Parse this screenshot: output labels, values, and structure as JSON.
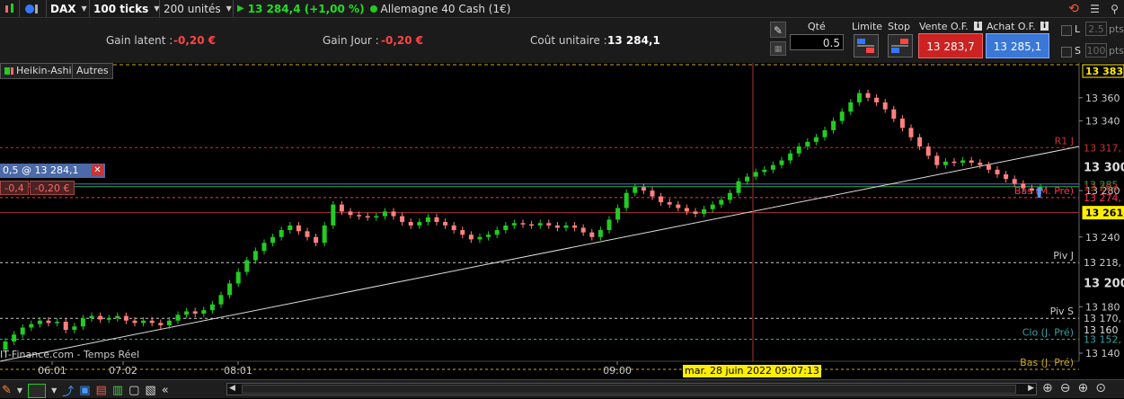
{
  "topbar": {
    "symbol": "DAX",
    "ticks": "100 ticks",
    "units": "200 unités",
    "price_change": "13 284,4 (+1,00 %)",
    "instrument": "Allemagne 40 Cash (1€)"
  },
  "info": {
    "gain_latent_label": "Gain latent :",
    "gain_latent_value": "-0,20 €",
    "gain_jour_label": "Gain Jour :",
    "gain_jour_value": "-0,20 €",
    "cout_label": "Coût unitaire :",
    "cout_value": "13 284,1"
  },
  "order": {
    "qty_label": "Qté",
    "qty_value": "0.5",
    "limite_label": "Limite",
    "stop_label": "Stop",
    "vente_label": "Vente O.F.",
    "achat_label": "Achat O.F.",
    "vente_price": "13 283,7",
    "achat_price": "13 285,1",
    "l_label": "L",
    "l_value": "2.5",
    "s_label": "S",
    "s_value": "100",
    "pts": "pts"
  },
  "chart_tabs": {
    "heikin": "Heikin-Ashi",
    "autres": "Autres"
  },
  "position": {
    "label": "0,5 @ 13 284,1",
    "delta": "-0,4",
    "pnl": "-0,20 €"
  },
  "watermark": "IT-Finance.com - Temps Réel",
  "crosshair_date": "mar. 28 juin 2022 09:07:13",
  "colors": {
    "up": "#22cc22",
    "down": "#ff8080",
    "line_red": "#cc2222",
    "accent_yellow": "#ffee00"
  },
  "chart_data": {
    "type": "candlestick",
    "ylim": [
      13133,
      13390
    ],
    "y_ticks": [
      13140,
      13180,
      13240,
      13280,
      13340,
      13360
    ],
    "x_ticks": [
      "06:01",
      "07:02",
      "08:01",
      "09:00"
    ],
    "levels": [
      {
        "label": "R1 J",
        "value": 13317,
        "axis_label": "13 317,",
        "color": "#cc3333"
      },
      {
        "label": "Bas (M. Pré)",
        "value": 13274,
        "axis_label": "13 274,",
        "color": "#ff3355"
      },
      {
        "label": "Piv J",
        "value": 13218,
        "axis_label": "13 218,",
        "color": "#cccccc"
      },
      {
        "label": "Piv S",
        "value": 13170,
        "axis_label": "13 170,",
        "color": "#cccccc"
      },
      {
        "label": "Clo (J. Pré)",
        "value": 13152,
        "axis_label": "13 152,",
        "color": "#3aa0a0"
      },
      {
        "label": "Bas (J. Pré)",
        "value": 13126,
        "axis_label": "",
        "color": "#ccaa22"
      }
    ],
    "highlight_labels": [
      {
        "value": 13383,
        "text": "13 383,"
      },
      {
        "value": 13261,
        "text": "13 261,"
      }
    ],
    "current_price_labels": [
      {
        "value": 13300,
        "text": "13 300"
      },
      {
        "value": 13285,
        "text": "13 285"
      },
      {
        "value": 13283,
        "text": "13 283,"
      },
      {
        "value": 13200,
        "text": "13 200"
      },
      {
        "value": 13160,
        "text": "13 160"
      }
    ],
    "candles": [
      [
        13143,
        13150
      ],
      [
        13150,
        13156
      ],
      [
        13156,
        13162
      ],
      [
        13162,
        13165
      ],
      [
        13165,
        13168
      ],
      [
        13168,
        13166
      ],
      [
        13166,
        13167
      ],
      [
        13167,
        13160
      ],
      [
        13160,
        13163
      ],
      [
        13163,
        13170
      ],
      [
        13170,
        13172
      ],
      [
        13172,
        13169
      ],
      [
        13169,
        13170
      ],
      [
        13170,
        13172
      ],
      [
        13172,
        13168
      ],
      [
        13168,
        13166
      ],
      [
        13166,
        13168
      ],
      [
        13168,
        13166
      ],
      [
        13166,
        13164
      ],
      [
        13164,
        13168
      ],
      [
        13168,
        13173
      ],
      [
        13173,
        13176
      ],
      [
        13176,
        13174
      ],
      [
        13174,
        13177
      ],
      [
        13177,
        13182
      ],
      [
        13182,
        13190
      ],
      [
        13190,
        13200
      ],
      [
        13200,
        13210
      ],
      [
        13210,
        13220
      ],
      [
        13220,
        13228
      ],
      [
        13228,
        13235
      ],
      [
        13235,
        13240
      ],
      [
        13240,
        13246
      ],
      [
        13246,
        13250
      ],
      [
        13250,
        13245
      ],
      [
        13245,
        13240
      ],
      [
        13240,
        13235
      ],
      [
        13235,
        13250
      ],
      [
        13250,
        13268
      ],
      [
        13268,
        13262
      ],
      [
        13262,
        13259
      ],
      [
        13259,
        13258
      ],
      [
        13258,
        13257
      ],
      [
        13257,
        13258
      ],
      [
        13258,
        13262
      ],
      [
        13262,
        13258
      ],
      [
        13258,
        13253
      ],
      [
        13253,
        13250
      ],
      [
        13250,
        13253
      ],
      [
        13253,
        13257
      ],
      [
        13257,
        13253
      ],
      [
        13253,
        13250
      ],
      [
        13250,
        13246
      ],
      [
        13246,
        13242
      ],
      [
        13242,
        13238
      ],
      [
        13238,
        13240
      ],
      [
        13240,
        13242
      ],
      [
        13242,
        13246
      ],
      [
        13246,
        13250
      ],
      [
        13250,
        13252
      ],
      [
        13252,
        13251
      ],
      [
        13251,
        13250
      ],
      [
        13250,
        13252
      ],
      [
        13252,
        13250
      ],
      [
        13250,
        13248
      ],
      [
        13248,
        13250
      ],
      [
        13250,
        13248
      ],
      [
        13248,
        13244
      ],
      [
        13244,
        13240
      ],
      [
        13240,
        13246
      ],
      [
        13246,
        13255
      ],
      [
        13255,
        13265
      ],
      [
        13265,
        13278
      ],
      [
        13278,
        13283
      ],
      [
        13283,
        13280
      ],
      [
        13280,
        13275
      ],
      [
        13275,
        13270
      ],
      [
        13270,
        13268
      ],
      [
        13268,
        13265
      ],
      [
        13265,
        13262
      ],
      [
        13262,
        13260
      ],
      [
        13260,
        13264
      ],
      [
        13264,
        13268
      ],
      [
        13268,
        13272
      ],
      [
        13272,
        13278
      ],
      [
        13278,
        13288
      ],
      [
        13288,
        13292
      ],
      [
        13292,
        13296
      ],
      [
        13296,
        13298
      ],
      [
        13298,
        13302
      ],
      [
        13302,
        13306
      ],
      [
        13306,
        13312
      ],
      [
        13312,
        13318
      ],
      [
        13318,
        13322
      ],
      [
        13322,
        13326
      ],
      [
        13326,
        13332
      ],
      [
        13332,
        13340
      ],
      [
        13340,
        13348
      ],
      [
        13348,
        13356
      ],
      [
        13356,
        13364
      ],
      [
        13364,
        13360
      ],
      [
        13360,
        13356
      ],
      [
        13356,
        13350
      ],
      [
        13350,
        13342
      ],
      [
        13342,
        13334
      ],
      [
        13334,
        13326
      ],
      [
        13326,
        13318
      ],
      [
        13318,
        13310
      ],
      [
        13310,
        13302
      ],
      [
        13302,
        13305
      ],
      [
        13305,
        13304
      ],
      [
        13304,
        13306
      ],
      [
        13306,
        13304
      ],
      [
        13304,
        13302
      ],
      [
        13302,
        13298
      ],
      [
        13298,
        13294
      ],
      [
        13294,
        13290
      ],
      [
        13290,
        13286
      ],
      [
        13286,
        13282
      ],
      [
        13282,
        13280
      ],
      [
        13280,
        13283
      ]
    ],
    "trendline": {
      "from": 13133,
      "to": 13318
    }
  },
  "icons": [
    "chart-type-icon",
    "style-icon",
    "network-icon",
    "calendar-icon",
    "zoom-in-icon",
    "zoom-out-icon"
  ]
}
